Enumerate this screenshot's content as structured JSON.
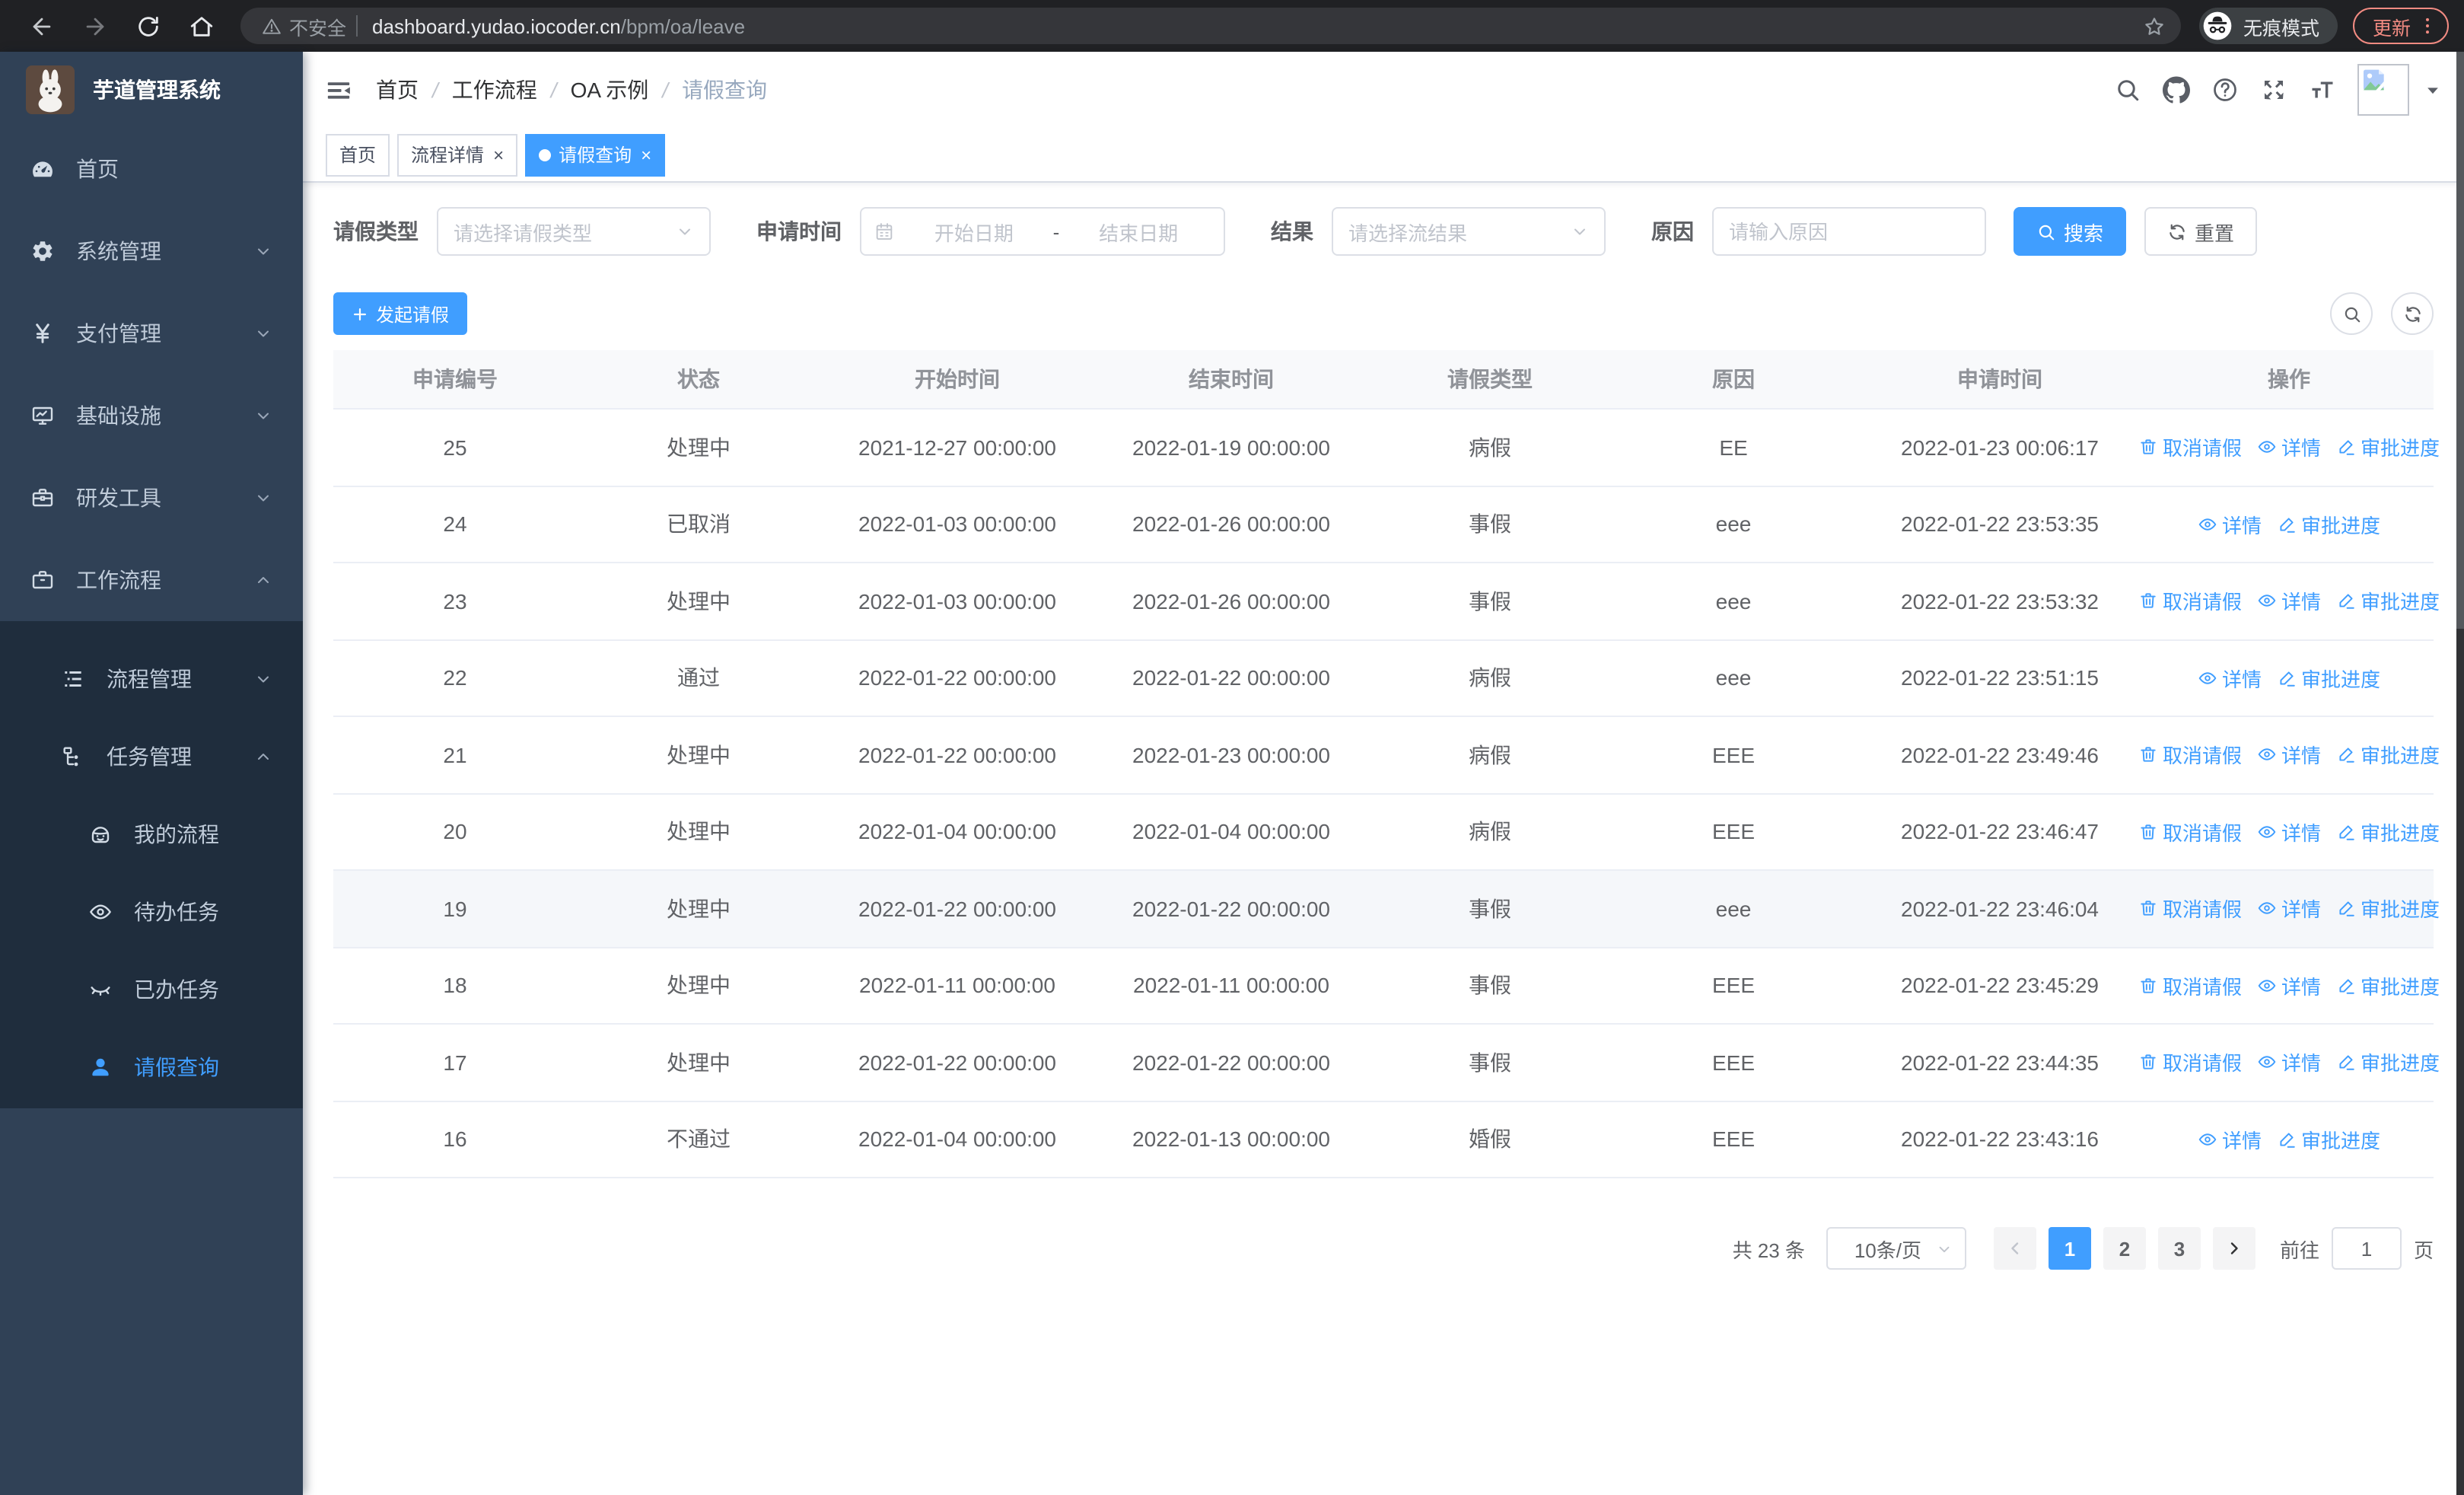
{
  "browser": {
    "nav_icons": [
      "back-icon",
      "forward-icon",
      "reload-icon",
      "home-icon"
    ],
    "security_label": "不安全",
    "url_host": "dashboard.yudao.iocoder.cn",
    "url_path": "/bpm/oa/leave",
    "incognito_label": "无痕模式",
    "update_label": "更新"
  },
  "sidebar": {
    "logo_title": "芋道管理系统",
    "menu": [
      {
        "label": "首页",
        "icon": "dashboard-icon"
      },
      {
        "label": "系统管理",
        "icon": "gear-icon",
        "chevron": "down"
      },
      {
        "label": "支付管理",
        "icon": "yen-icon",
        "chevron": "down"
      },
      {
        "label": "基础设施",
        "icon": "monitor-icon",
        "chevron": "down"
      },
      {
        "label": "研发工具",
        "icon": "toolbox-icon",
        "chevron": "down"
      },
      {
        "label": "工作流程",
        "icon": "briefcase-icon",
        "chevron": "up",
        "expanded": true,
        "children": [
          {
            "label": "流程管理",
            "icon": "tree-list-icon",
            "chevron": "down"
          },
          {
            "label": "任务管理",
            "icon": "org-icon",
            "chevron": "up",
            "expanded": true,
            "children": [
              {
                "label": "我的流程",
                "icon": "face-icon"
              },
              {
                "label": "待办任务",
                "icon": "eye-open-icon"
              },
              {
                "label": "已办任务",
                "icon": "eye-closed-icon"
              },
              {
                "label": "请假查询",
                "icon": "person-icon",
                "active": true
              }
            ]
          }
        ]
      }
    ]
  },
  "navbar": {
    "breadcrumbs": [
      "首页",
      "工作流程",
      "OA 示例",
      "请假查询"
    ],
    "separator": "/",
    "icons": [
      "search-icon",
      "github-icon",
      "question-icon",
      "fullscreen-icon",
      "font-size-icon"
    ]
  },
  "tabs": [
    {
      "label": "首页",
      "closable": false,
      "active": false
    },
    {
      "label": "流程详情",
      "closable": true,
      "active": false
    },
    {
      "label": "请假查询",
      "closable": true,
      "active": true
    }
  ],
  "filters": {
    "leave_type_label": "请假类型",
    "leave_type_placeholder": "请选择请假类型",
    "apply_time_label": "申请时间",
    "start_placeholder": "开始日期",
    "range_separator": "-",
    "end_placeholder": "结束日期",
    "result_label": "结果",
    "result_placeholder": "请选择流结果",
    "reason_label": "原因",
    "reason_placeholder": "请输入原因",
    "search_label": "搜索",
    "reset_label": "重置"
  },
  "toolbar": {
    "create_label": "发起请假"
  },
  "table": {
    "columns": [
      "申请编号",
      "状态",
      "开始时间",
      "结束时间",
      "请假类型",
      "原因",
      "申请时间",
      "操作"
    ],
    "actions": {
      "cancel": {
        "label": "取消请假",
        "icon": "trash-icon"
      },
      "detail": {
        "label": "详情",
        "icon": "eye-open-icon"
      },
      "progress": {
        "label": "审批进度",
        "icon": "pen-icon"
      }
    },
    "rows": [
      {
        "id": "25",
        "status": "处理中",
        "start": "2021-12-27 00:00:00",
        "end": "2022-01-19 00:00:00",
        "type": "病假",
        "reason": "EE",
        "applied": "2022-01-23 00:06:17",
        "actions": [
          "cancel",
          "detail",
          "progress"
        ],
        "highlight": false
      },
      {
        "id": "24",
        "status": "已取消",
        "start": "2022-01-03 00:00:00",
        "end": "2022-01-26 00:00:00",
        "type": "事假",
        "reason": "eee",
        "applied": "2022-01-22 23:53:35",
        "actions": [
          "detail",
          "progress"
        ],
        "highlight": false
      },
      {
        "id": "23",
        "status": "处理中",
        "start": "2022-01-03 00:00:00",
        "end": "2022-01-26 00:00:00",
        "type": "事假",
        "reason": "eee",
        "applied": "2022-01-22 23:53:32",
        "actions": [
          "cancel",
          "detail",
          "progress"
        ],
        "highlight": false
      },
      {
        "id": "22",
        "status": "通过",
        "start": "2022-01-22 00:00:00",
        "end": "2022-01-22 00:00:00",
        "type": "病假",
        "reason": "eee",
        "applied": "2022-01-22 23:51:15",
        "actions": [
          "detail",
          "progress"
        ],
        "highlight": false
      },
      {
        "id": "21",
        "status": "处理中",
        "start": "2022-01-22 00:00:00",
        "end": "2022-01-23 00:00:00",
        "type": "病假",
        "reason": "EEE",
        "applied": "2022-01-22 23:49:46",
        "actions": [
          "cancel",
          "detail",
          "progress"
        ],
        "highlight": false
      },
      {
        "id": "20",
        "status": "处理中",
        "start": "2022-01-04 00:00:00",
        "end": "2022-01-04 00:00:00",
        "type": "病假",
        "reason": "EEE",
        "applied": "2022-01-22 23:46:47",
        "actions": [
          "cancel",
          "detail",
          "progress"
        ],
        "highlight": false
      },
      {
        "id": "19",
        "status": "处理中",
        "start": "2022-01-22 00:00:00",
        "end": "2022-01-22 00:00:00",
        "type": "事假",
        "reason": "eee",
        "applied": "2022-01-22 23:46:04",
        "actions": [
          "cancel",
          "detail",
          "progress"
        ],
        "highlight": true
      },
      {
        "id": "18",
        "status": "处理中",
        "start": "2022-01-11 00:00:00",
        "end": "2022-01-11 00:00:00",
        "type": "事假",
        "reason": "EEE",
        "applied": "2022-01-22 23:45:29",
        "actions": [
          "cancel",
          "detail",
          "progress"
        ],
        "highlight": false
      },
      {
        "id": "17",
        "status": "处理中",
        "start": "2022-01-22 00:00:00",
        "end": "2022-01-22 00:00:00",
        "type": "事假",
        "reason": "EEE",
        "applied": "2022-01-22 23:44:35",
        "actions": [
          "cancel",
          "detail",
          "progress"
        ],
        "highlight": false
      },
      {
        "id": "16",
        "status": "不通过",
        "start": "2022-01-04 00:00:00",
        "end": "2022-01-13 00:00:00",
        "type": "婚假",
        "reason": "EEE",
        "applied": "2022-01-22 23:43:16",
        "actions": [
          "detail",
          "progress"
        ],
        "highlight": false
      }
    ]
  },
  "pagination": {
    "total_label": "共 23 条",
    "page_size_label": "10条/页",
    "pages": [
      "1",
      "2",
      "3"
    ],
    "active_page": "1",
    "goto_label": "前往",
    "goto_value": "1",
    "unit_label": "页"
  },
  "colors": {
    "accent": "#409eff",
    "sidebar_bg": "#304156",
    "submenu_bg": "#1f2d3d",
    "link": "#409eff"
  }
}
